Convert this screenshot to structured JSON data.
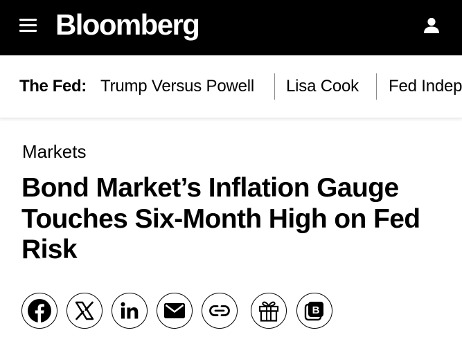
{
  "header": {
    "logo": "Bloomberg",
    "icons": {
      "menu": "hamburger-menu-icon",
      "account": "user-icon"
    },
    "background": "#000000",
    "foreground": "#ffffff"
  },
  "topic_bar": {
    "label": "The Fed:",
    "links": [
      "Trump Versus Powell",
      "Lisa Cook",
      "Fed Indep"
    ]
  },
  "article": {
    "section": "Markets",
    "headline": "Bond Market’s Inflation Gauge Touches Six-Month High on Fed Risk"
  },
  "share_bar": {
    "buttons": [
      {
        "name": "facebook",
        "icon": "facebook-icon"
      },
      {
        "name": "x",
        "icon": "x-icon"
      },
      {
        "name": "linkedin",
        "icon": "linkedin-icon"
      },
      {
        "name": "email",
        "icon": "mail-icon"
      },
      {
        "name": "copy-link",
        "icon": "link-icon"
      },
      {
        "name": "gift",
        "icon": "gift-icon"
      },
      {
        "name": "bloomberg",
        "icon": "bloomberg-b-icon",
        "label": "B"
      }
    ]
  }
}
